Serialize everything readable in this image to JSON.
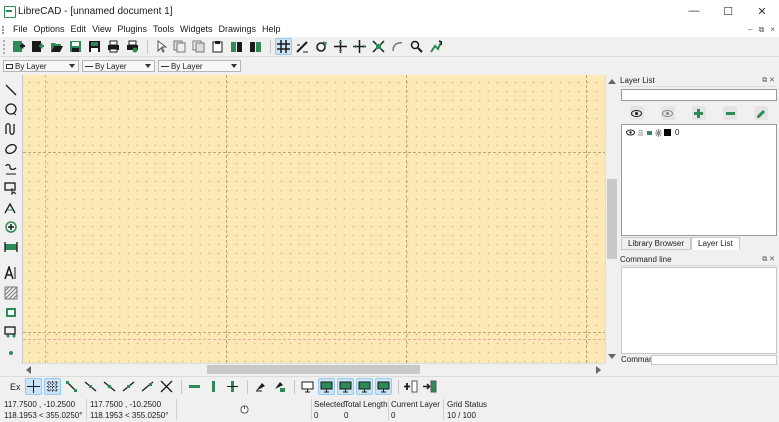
{
  "window": {
    "title": "LibreCAD - [unnamed document 1]",
    "minimize": "—",
    "maximize": "☐",
    "close": "✕"
  },
  "menubar": {
    "items": [
      "File",
      "Options",
      "Edit",
      "View",
      "Plugins",
      "Tools",
      "Widgets",
      "Drawings",
      "Help"
    ],
    "mdi": [
      "–",
      "⧉",
      "×"
    ]
  },
  "pen_toolbar": {
    "color": "By Layer",
    "width": "By Layer",
    "type": "By Layer"
  },
  "layer_list": {
    "title": "Layer List",
    "search_value": "",
    "layers": [
      {
        "name": "0",
        "color": "#000000"
      }
    ]
  },
  "dock_tabs": [
    "Library Browser",
    "Layer List"
  ],
  "dock_tab_active": "Layer List",
  "command": {
    "title": "Command line",
    "label": "Command:",
    "value": ""
  },
  "snap_toolbar": {
    "label": "Ex"
  },
  "status": {
    "abs_coord": "117.7500 , -10.2500",
    "abs_polar": "118.1953 < 355.0250°",
    "rel_coord": "117.7500 , -10.2500",
    "rel_polar": "118.1953 < 355.0250°",
    "selected_label": "Selected",
    "selected_value": "0",
    "length_label": "Total Length",
    "length_value": "0",
    "layer_label": "Current Layer",
    "layer_value": "0",
    "grid_label": "Grid Status",
    "grid_value": "10 / 100"
  },
  "colors": {
    "canvas_bg": "#fce9b6",
    "icon_green": "#2e8b57",
    "active_toggle": "#cce4f7"
  }
}
